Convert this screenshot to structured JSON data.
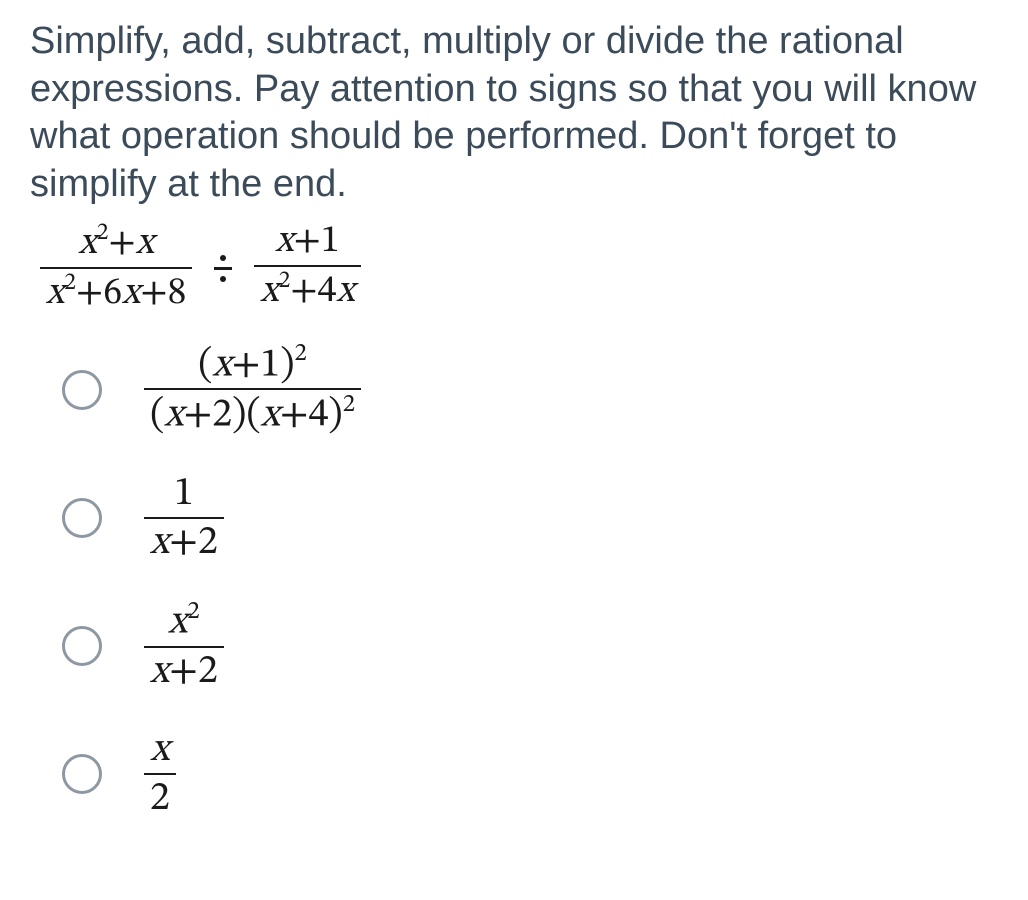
{
  "question": {
    "prompt": "Simplify, add, subtract, multiply or divide the rational expressions. Pay attention to signs so that you will know what operation should be performed. Don't forget to simplify at the end.",
    "expression": {
      "left": {
        "numerator": "x²+x",
        "denominator": "x²+6x+8"
      },
      "operator": "÷",
      "right": {
        "numerator": "x+1",
        "denominator": "x²+4x"
      }
    }
  },
  "choices": [
    {
      "id": "A",
      "numerator": "(x+1)²",
      "denominator": "(x+2)(x+4)²"
    },
    {
      "id": "B",
      "numerator": "1",
      "denominator": "x+2"
    },
    {
      "id": "C",
      "numerator": "x²",
      "denominator": "x+2"
    },
    {
      "id": "D",
      "numerator": "x",
      "denominator": "2"
    }
  ]
}
